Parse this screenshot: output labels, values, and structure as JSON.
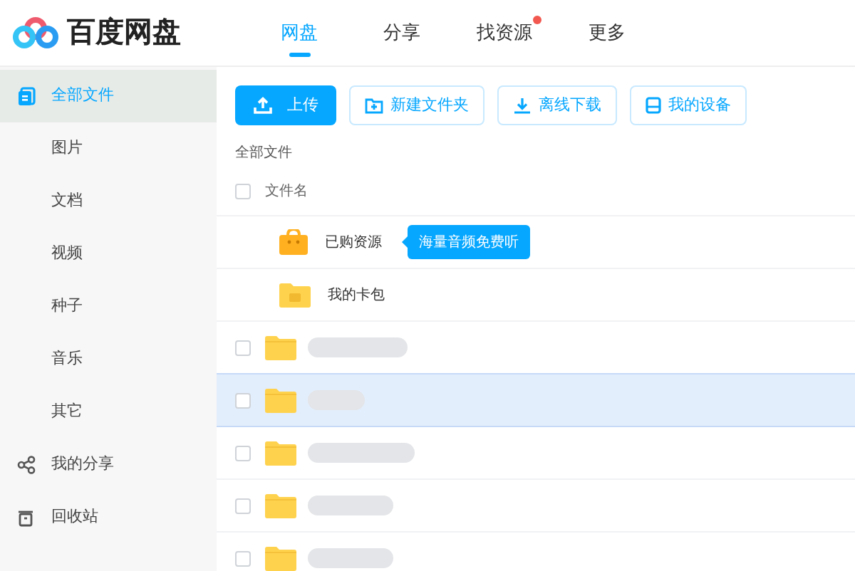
{
  "logo": {
    "text": "百度网盘"
  },
  "nav": [
    {
      "label": "网盘",
      "selected": true,
      "dot": false
    },
    {
      "label": "分享",
      "selected": false,
      "dot": false
    },
    {
      "label": "找资源",
      "selected": false,
      "dot": true
    },
    {
      "label": "更多",
      "selected": false,
      "dot": false
    }
  ],
  "sidebar": {
    "items": [
      {
        "label": "全部文件",
        "kind": "files",
        "selected": true
      },
      {
        "label": "图片",
        "kind": "sub",
        "selected": false
      },
      {
        "label": "文档",
        "kind": "sub",
        "selected": false
      },
      {
        "label": "视频",
        "kind": "sub",
        "selected": false
      },
      {
        "label": "种子",
        "kind": "sub",
        "selected": false
      },
      {
        "label": "音乐",
        "kind": "sub",
        "selected": false
      },
      {
        "label": "其它",
        "kind": "sub",
        "selected": false
      },
      {
        "label": "我的分享",
        "kind": "share",
        "selected": false
      },
      {
        "label": "回收站",
        "kind": "trash",
        "selected": false
      }
    ]
  },
  "toolbar": [
    {
      "label": "上传",
      "kind": "upload"
    },
    {
      "label": "新建文件夹",
      "kind": "newfolder"
    },
    {
      "label": "离线下载",
      "kind": "download"
    },
    {
      "label": "我的设备",
      "kind": "device"
    }
  ],
  "breadcrumb": "全部文件",
  "table": {
    "header": {
      "label": "文件名",
      "checked": false
    },
    "rows": [
      {
        "kind": "bag",
        "name": "已购资源",
        "tooltip": "海量音频免费听"
      },
      {
        "kind": "wallet",
        "name": "我的卡包"
      },
      {
        "kind": "folder",
        "checked": false,
        "highlighted": false
      },
      {
        "kind": "folder",
        "checked": false,
        "highlighted": true
      },
      {
        "kind": "folder",
        "checked": false,
        "highlighted": false
      },
      {
        "kind": "folder",
        "checked": false,
        "highlighted": false
      },
      {
        "kind": "folder",
        "checked": false,
        "highlighted": false
      }
    ]
  }
}
